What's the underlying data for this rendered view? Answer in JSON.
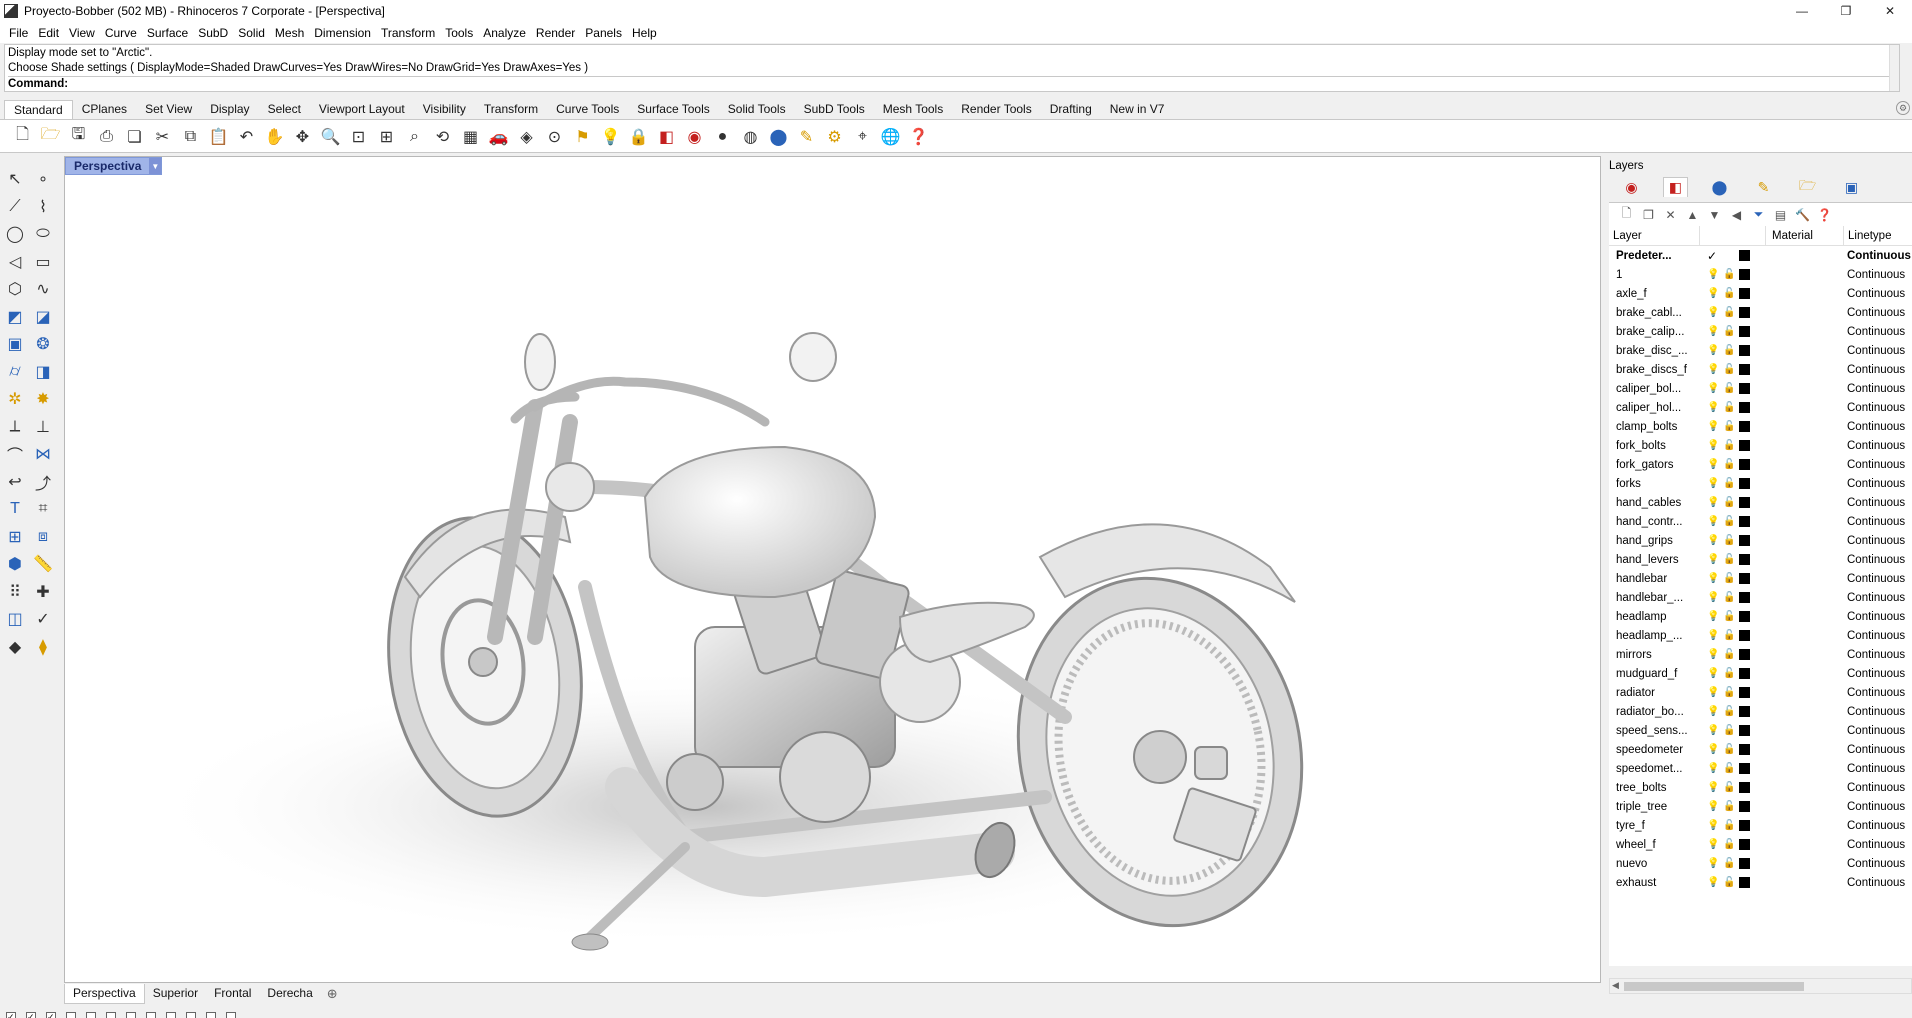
{
  "window": {
    "title": "Proyecto-Bobber (502 MB) - Rhinoceros 7 Corporate - [Perspectiva]",
    "controls": [
      "—",
      "❐",
      "✕"
    ]
  },
  "menu": [
    "File",
    "Edit",
    "View",
    "Curve",
    "Surface",
    "SubD",
    "Solid",
    "Mesh",
    "Dimension",
    "Transform",
    "Tools",
    "Analyze",
    "Render",
    "Panels",
    "Help"
  ],
  "command": {
    "history": [
      "Display mode set to \"Arctic\".",
      "Choose Shade settings ( DisplayMode=Shaded  DrawCurves=Yes  DrawWires=No  DrawGrid=Yes  DrawAxes=Yes )"
    ],
    "prompt": "Command:"
  },
  "toolbar_tabs": [
    "Standard",
    "CPlanes",
    "Set View",
    "Display",
    "Select",
    "Viewport Layout",
    "Visibility",
    "Transform",
    "Curve Tools",
    "Surface Tools",
    "Solid Tools",
    "SubD Tools",
    "Mesh Tools",
    "Render Tools",
    "Drafting",
    "New in V7"
  ],
  "viewport": {
    "name": "Perspectiva",
    "tabs": [
      "Perspectiva",
      "Superior",
      "Frontal",
      "Derecha"
    ],
    "add_tab": "⊕"
  },
  "layers_panel": {
    "title": "Layers",
    "columns": {
      "layer": "Layer",
      "material": "Material",
      "linetype": "Linetype"
    },
    "current_layer": "Predeter...",
    "linetype_default": "Continuous",
    "rows": [
      {
        "name": "Predeter...",
        "current": true,
        "linetype": "Continuous"
      },
      {
        "name": "1",
        "linetype": "Continuous"
      },
      {
        "name": "axle_f",
        "linetype": "Continuous"
      },
      {
        "name": "brake_cabl...",
        "linetype": "Continuous"
      },
      {
        "name": "brake_calip...",
        "linetype": "Continuous"
      },
      {
        "name": "brake_disc_...",
        "linetype": "Continuous"
      },
      {
        "name": "brake_discs_f",
        "linetype": "Continuous"
      },
      {
        "name": "caliper_bol...",
        "linetype": "Continuous"
      },
      {
        "name": "caliper_hol...",
        "linetype": "Continuous"
      },
      {
        "name": "clamp_bolts",
        "linetype": "Continuous"
      },
      {
        "name": "fork_bolts",
        "linetype": "Continuous"
      },
      {
        "name": "fork_gators",
        "linetype": "Continuous"
      },
      {
        "name": "forks",
        "linetype": "Continuous"
      },
      {
        "name": "hand_cables",
        "linetype": "Continuous"
      },
      {
        "name": "hand_contr...",
        "linetype": "Continuous"
      },
      {
        "name": "hand_grips",
        "linetype": "Continuous"
      },
      {
        "name": "hand_levers",
        "linetype": "Continuous"
      },
      {
        "name": "handlebar",
        "linetype": "Continuous"
      },
      {
        "name": "handlebar_...",
        "linetype": "Continuous"
      },
      {
        "name": "headlamp",
        "linetype": "Continuous"
      },
      {
        "name": "headlamp_...",
        "linetype": "Continuous"
      },
      {
        "name": "mirrors",
        "linetype": "Continuous"
      },
      {
        "name": "mudguard_f",
        "linetype": "Continuous"
      },
      {
        "name": "radiator",
        "linetype": "Continuous"
      },
      {
        "name": "radiator_bo...",
        "linetype": "Continuous"
      },
      {
        "name": "speed_sens...",
        "linetype": "Continuous"
      },
      {
        "name": "speedometer",
        "linetype": "Continuous"
      },
      {
        "name": "speedomet...",
        "linetype": "Continuous"
      },
      {
        "name": "tree_bolts",
        "linetype": "Continuous"
      },
      {
        "name": "triple_tree",
        "linetype": "Continuous"
      },
      {
        "name": "tyre_f",
        "linetype": "Continuous"
      },
      {
        "name": "wheel_f",
        "linetype": "Continuous"
      },
      {
        "name": "nuevo",
        "linetype": "Continuous"
      },
      {
        "name": "exhaust",
        "linetype": "Continuous"
      }
    ]
  },
  "colors": {
    "viewport_tab": "#a0b4e8",
    "layer_bulb": "#d8b000",
    "layer_color": "#000000"
  }
}
